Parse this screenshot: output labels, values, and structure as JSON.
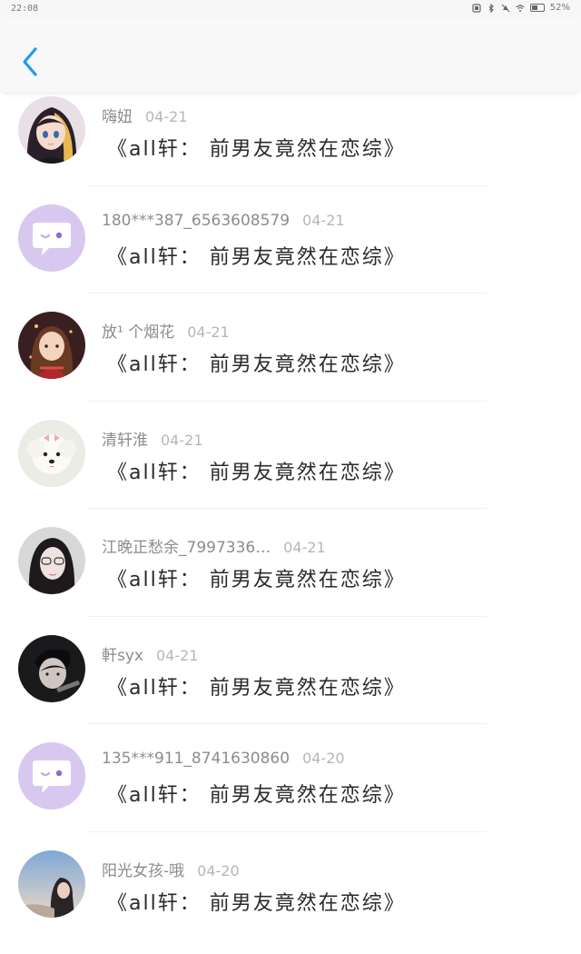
{
  "status_bar": {
    "time": "22:08",
    "battery_percent": "52%",
    "battery_level": 0.52,
    "icons": [
      "screenshot-icon",
      "bluetooth-icon",
      "mute-icon",
      "wifi-icon",
      "battery-icon"
    ]
  },
  "header": {
    "back_icon": "chevron-left-icon",
    "accent_color": "#1e9bf0"
  },
  "comments": [
    {
      "name": "嗨妞",
      "date": "04-21",
      "title": "《all轩：  前男友竟然在恋综》",
      "avatar": "anime-girl"
    },
    {
      "name": "180***387_6563608579",
      "date": "04-21",
      "title": "《all轩：  前男友竟然在恋综》",
      "avatar": "default-chat-icon"
    },
    {
      "name": "放¹ 个烟花",
      "date": "04-21",
      "title": "《all轩：  前男友竟然在恋综》",
      "avatar": "illustrated-girl"
    },
    {
      "name": "清轩淮",
      "date": "04-21",
      "title": "《all轩：  前男友竟然在恋综》",
      "avatar": "white-puppy"
    },
    {
      "name": "江晚正愁余_7997336…",
      "date": "04-21",
      "title": "《all轩：  前男友竟然在恋综》",
      "avatar": "girl-photo"
    },
    {
      "name": "軒syx",
      "date": "04-21",
      "title": "《all轩：  前男友竟然在恋综》",
      "avatar": "boy-photo"
    },
    {
      "name": "135***911_8741630860",
      "date": "04-20",
      "title": "《all轩：  前男友竟然在恋综》",
      "avatar": "default-chat-icon"
    },
    {
      "name": "阳光女孩-哦",
      "date": "04-20",
      "title": "《all轩：  前男友竟然在恋综》",
      "avatar": "sky-photo"
    }
  ]
}
